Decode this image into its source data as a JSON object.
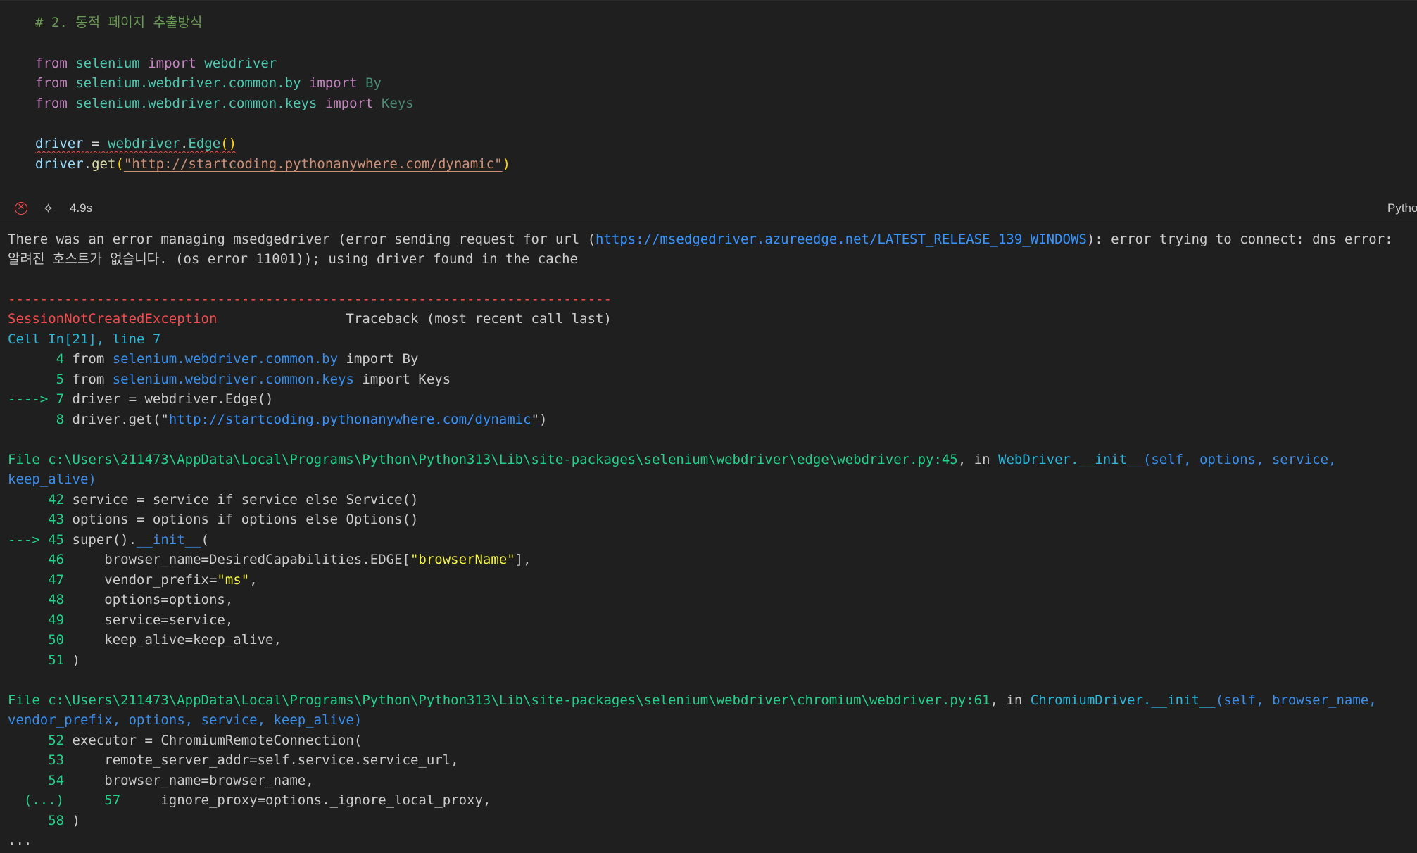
{
  "code_cell": {
    "comment": "# 2. 동적 페이지 추출방식",
    "lines": {
      "l1": {
        "kw1": "from",
        "mod": "selenium",
        "kw2": "import",
        "name": "webdriver"
      },
      "l2": {
        "kw1": "from",
        "mod": "selenium.webdriver.common.by",
        "kw2": "import",
        "name": "By"
      },
      "l3": {
        "kw1": "from",
        "mod": "selenium.webdriver.common.keys",
        "kw2": "import",
        "name": "Keys"
      },
      "l4": {
        "var": "driver",
        "op": "=",
        "obj": "webdriver",
        "dot": ".",
        "cls": "Edge",
        "parens": "()"
      },
      "l5": {
        "var": "driver",
        "dot": ".",
        "fn": "get",
        "open": "(",
        "str": "\"http://startcoding.pythonanywhere.com/dynamic\"",
        "close": ")"
      }
    }
  },
  "status_bar": {
    "error_icon": "circle-x-icon",
    "sparkle_icon": "sparkle-icon",
    "time": "4.9s",
    "language": "Python"
  },
  "output": {
    "warning_line1_pre": "There was an error managing msedgedriver (error sending request for url (",
    "warning_url": "https://msedgedriver.azureedge.net/LATEST_RELEASE_139_WINDOWS",
    "warning_line1_post": "): error trying to connect: dns error:",
    "warning_line2": "알려진 호스트가 없습니다. (os error 11001)); using driver found in the cache",
    "divider": "---------------------------------------------------------------------------",
    "exception_name": "SessionNotCreatedException",
    "traceback_gap": "                ",
    "traceback_title": "Traceback (most recent call last)",
    "cell_ref": "Cell In[21], line 7",
    "cell_lines": {
      "a": {
        "num": "      4 ",
        "kw": "from ",
        "mod": "selenium.webdriver.common.by",
        "rest": " import By"
      },
      "b": {
        "num": "      5 ",
        "kw": "from ",
        "mod": "selenium.webdriver.common.keys",
        "rest": " import Keys"
      },
      "c": {
        "arrow": "----> 7 ",
        "code": "driver = webdriver.Edge()"
      },
      "d": {
        "num": "      8 ",
        "pre": "driver.get(\"",
        "url": "http://startcoding.pythonanywhere.com/dynamic",
        "post": "\")"
      }
    },
    "frame1": {
      "file": "File c:\\Users\\211473\\AppData\\Local\\Programs\\Python\\Python313\\Lib\\site-packages\\selenium\\webdriver\\edge\\webdriver.py:45",
      "in": ", in ",
      "func": "WebDriver.__init__",
      "args1": "(self, options, service,",
      "args2": "keep_alive)",
      "lines": {
        "l42": {
          "num": "     42 ",
          "code": "service = service if service else Service()"
        },
        "l43": {
          "num": "     43 ",
          "code": "options = options if options else Options()"
        },
        "l45": {
          "arrow": "---> 45 ",
          "pre": "super().",
          "dunder": "__init__",
          "post": "("
        },
        "l46": {
          "num": "     46 ",
          "pre": "    browser_name=DesiredCapabilities.EDGE[",
          "str": "\"browserName\"",
          "post": "],"
        },
        "l47": {
          "num": "     47 ",
          "pre": "    vendor_prefix=",
          "str": "\"ms\"",
          "post": ","
        },
        "l48": {
          "num": "     48 ",
          "code": "    options=options,"
        },
        "l49": {
          "num": "     49 ",
          "code": "    service=service,"
        },
        "l50": {
          "num": "     50 ",
          "code": "    keep_alive=keep_alive,"
        },
        "l51": {
          "num": "     51 ",
          "code": ")"
        }
      }
    },
    "frame2": {
      "file": "File c:\\Users\\211473\\AppData\\Local\\Programs\\Python\\Python313\\Lib\\site-packages\\selenium\\webdriver\\chromium\\webdriver.py:61",
      "in": ", in ",
      "func": "ChromiumDriver.__init__",
      "args1": "(self, browser_name,",
      "args2": "vendor_prefix, options, service, keep_alive)",
      "lines": {
        "l52": {
          "num": "     52 ",
          "code": "executor = ChromiumRemoteConnection("
        },
        "l53": {
          "num": "     53 ",
          "code": "    remote_server_addr=self.service.service_url,"
        },
        "l54": {
          "num": "     54 ",
          "code": "    browser_name=browser_name,"
        },
        "l57": {
          "ellipsis": "  (...)",
          "num": "     57 ",
          "code": "    ignore_proxy=options._ignore_local_proxy,"
        },
        "l58": {
          "num": "     58 ",
          "code": ")"
        }
      }
    },
    "trailing": "..."
  }
}
